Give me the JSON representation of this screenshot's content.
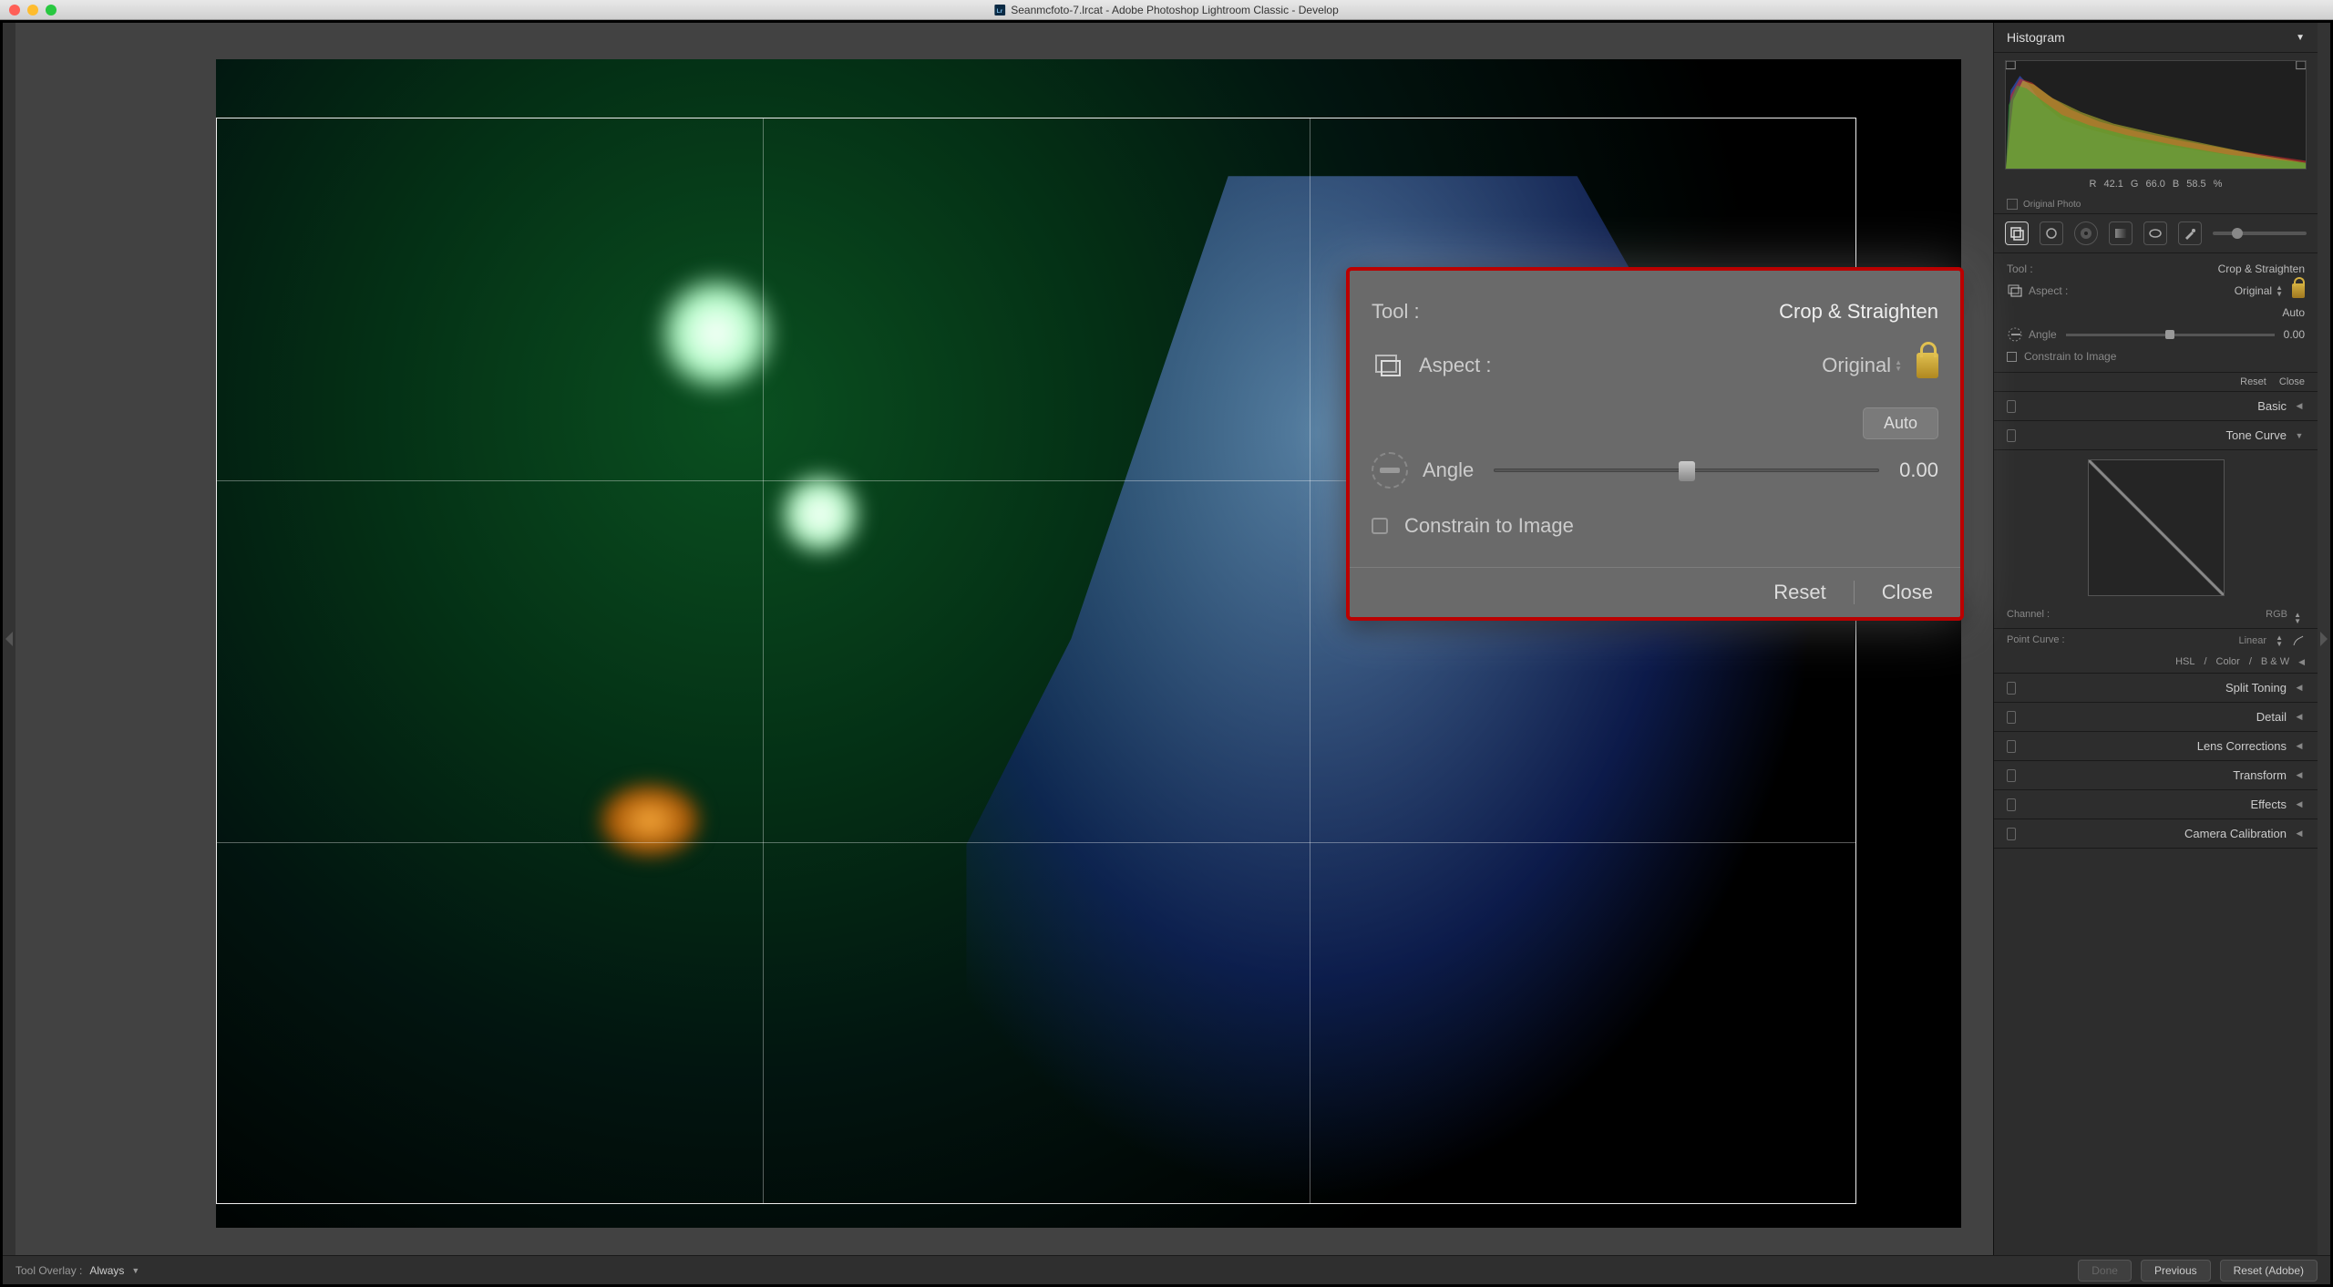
{
  "titlebar": {
    "title": "Seanmcfoto-7.lrcat - Adobe Photoshop Lightroom Classic - Develop"
  },
  "rightPanel": {
    "histogramLabel": "Histogram",
    "histoInfo": {
      "r_label": "R",
      "r": "42.1",
      "g_label": "G",
      "g": "66.0",
      "b_label": "B",
      "b": "58.5",
      "pct": "%"
    },
    "originalPhoto": "Original Photo",
    "tool": {
      "label": "Tool :",
      "name": "Crop & Straighten",
      "aspectLabel": "Aspect :",
      "aspectValue": "Original",
      "auto": "Auto",
      "angleLabel": "Angle",
      "angleValue": "0.00",
      "constrain": "Constrain to Image",
      "reset": "Reset",
      "close": "Close"
    },
    "panels": {
      "basic": "Basic",
      "toneCurve": "Tone Curve",
      "channelLabel": "Channel :",
      "channelValue": "RGB",
      "pointCurveLabel": "Point Curve :",
      "pointCurveValue": "Linear",
      "hsl": "HSL",
      "color": "Color",
      "bw": "B & W",
      "splitToning": "Split Toning",
      "detail": "Detail",
      "lensCorrections": "Lens Corrections",
      "transform": "Transform",
      "effects": "Effects",
      "cameraCalibration": "Camera Calibration"
    }
  },
  "popup": {
    "toolLabel": "Tool :",
    "toolName": "Crop & Straighten",
    "aspectLabel": "Aspect :",
    "aspectValue": "Original",
    "auto": "Auto",
    "angleLabel": "Angle",
    "angleValue": "0.00",
    "constrain": "Constrain to Image",
    "reset": "Reset",
    "close": "Close"
  },
  "bottomBar": {
    "toolOverlayLabel": "Tool Overlay :",
    "toolOverlayValue": "Always",
    "done": "Done",
    "previous": "Previous",
    "resetAdobe": "Reset (Adobe)"
  }
}
